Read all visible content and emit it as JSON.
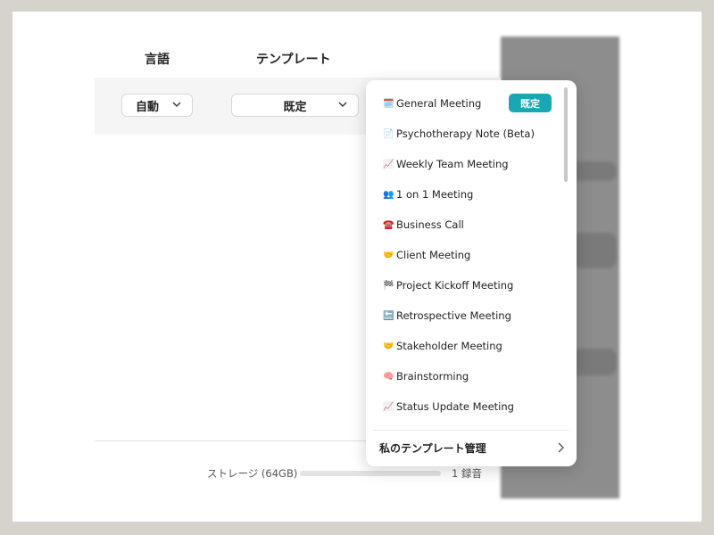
{
  "headers": {
    "language": "言語",
    "template": "テンプレート"
  },
  "language_select": {
    "value": "自動"
  },
  "template_select": {
    "value": "既定"
  },
  "dropdown": {
    "items": [
      {
        "emoji": "🗓️",
        "label": "General Meeting",
        "badge": "既定"
      },
      {
        "emoji": "📄",
        "label": "Psychotherapy Note (Beta)"
      },
      {
        "emoji": "📈",
        "label": "Weekly Team Meeting"
      },
      {
        "emoji": "👥",
        "label": "1 on 1 Meeting"
      },
      {
        "emoji": "☎️",
        "label": "Business Call"
      },
      {
        "emoji": "🤝",
        "label": "Client Meeting"
      },
      {
        "emoji": "🏁",
        "label": "Project Kickoff Meeting"
      },
      {
        "emoji": "🔙",
        "label": "Retrospective Meeting"
      },
      {
        "emoji": "🤝",
        "label": "Stakeholder Meeting"
      },
      {
        "emoji": "🧠",
        "label": "Brainstorming"
      },
      {
        "emoji": "📈",
        "label": "Status Update Meeting"
      }
    ],
    "manage_label": "私のテンプレート管理"
  },
  "footer": {
    "storage_label": "ストレージ (64GB)",
    "storage_used_fraction": 0.0,
    "record_count": "1 録音"
  },
  "colors": {
    "accent": "#1aa7b4"
  }
}
